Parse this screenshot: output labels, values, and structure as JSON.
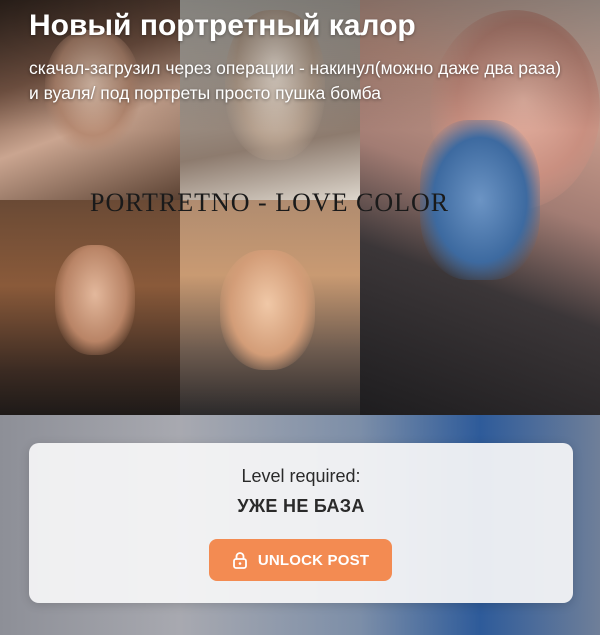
{
  "post": {
    "title": "Новый портретный калор",
    "description": "скачал-загрузил через операции - накинул(можно даже два раза) и вуаля/ под портреты просто пушка бомба",
    "image_watermark": "PORTRETNO - LOVE COLOR"
  },
  "lock_card": {
    "level_label": "Level required:",
    "level_value": "УЖЕ НЕ БАЗА",
    "unlock_label": "UNLOCK POST",
    "unlock_icon": "lock-icon",
    "accent_color": "#f38b52"
  }
}
